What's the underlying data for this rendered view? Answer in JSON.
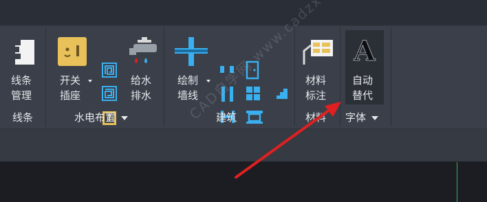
{
  "ribbon": {
    "groups": [
      {
        "label": "线条",
        "has_menu": false
      },
      {
        "label": "水电布置",
        "has_menu": true
      },
      {
        "label": "建筑",
        "has_menu": false
      },
      {
        "label": "材料",
        "has_menu": false
      },
      {
        "label": "字体",
        "has_menu": true
      }
    ],
    "buttons": {
      "line_manage": [
        "线条",
        "管理"
      ],
      "switch_socket": [
        "开关",
        "插座"
      ],
      "water_supply": [
        "给水",
        "排水"
      ],
      "draw_wall": [
        "绘制",
        "墙线"
      ],
      "material_label": [
        "材料",
        "标注"
      ],
      "auto_replace": [
        "自动",
        "替代"
      ]
    }
  },
  "watermark": "CAD自学网 www.cadzxw.com",
  "colors": {
    "accent_blue": "#3ab0f0",
    "socket_yellow": "#e8c15a",
    "arrow_red": "#e02020"
  }
}
